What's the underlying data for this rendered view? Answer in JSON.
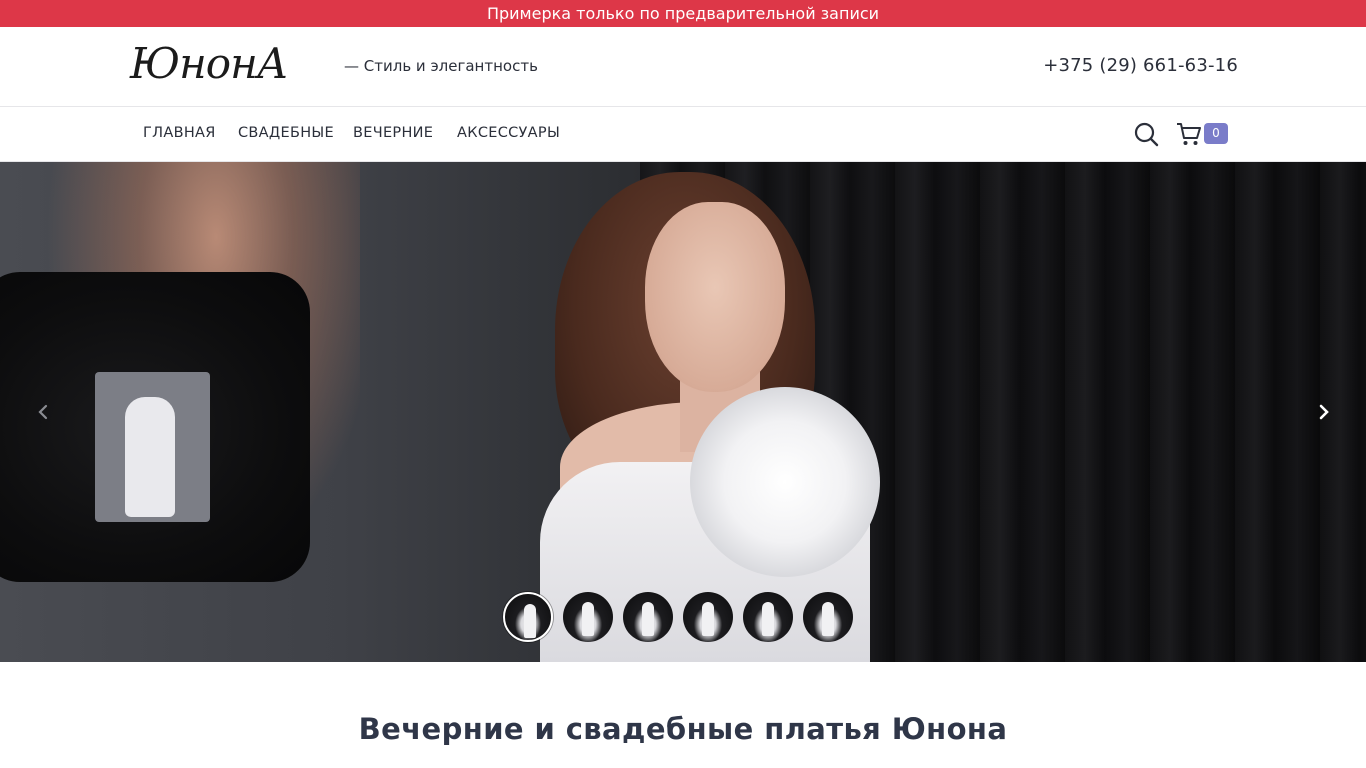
{
  "topbar": {
    "text": "Примерка только по предварительной записи"
  },
  "header": {
    "logo_text": "ЮнонА",
    "tagline": "— Стиль и элегантность",
    "phone": "+375 (29) 661-63-16"
  },
  "nav": {
    "items": [
      {
        "label": "ГЛАВНАЯ"
      },
      {
        "label": "СВАДЕБНЫЕ"
      },
      {
        "label": "ВЕЧЕРНИЕ"
      },
      {
        "label": "АКСЕССУАРЫ"
      }
    ],
    "search_icon": "search-icon",
    "cart_icon": "cart-icon",
    "cart_count": "0",
    "badge_color": "#7a7cc9"
  },
  "hero": {
    "thumb_count": 6,
    "active_thumb": 1
  },
  "content": {
    "title": "Вечерние и свадебные платья Юнона"
  },
  "colors": {
    "topbar": "#dd3748",
    "text": "#2b2f3a"
  }
}
